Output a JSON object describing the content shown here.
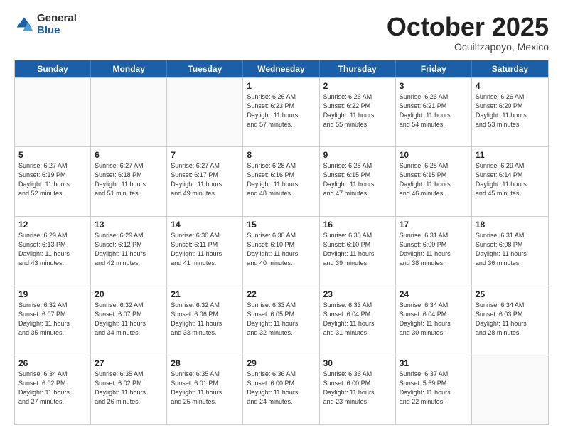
{
  "logo": {
    "general": "General",
    "blue": "Blue"
  },
  "header": {
    "title": "October 2025",
    "subtitle": "Ocuiltzapoyo, Mexico"
  },
  "weekdays": [
    "Sunday",
    "Monday",
    "Tuesday",
    "Wednesday",
    "Thursday",
    "Friday",
    "Saturday"
  ],
  "weeks": [
    [
      {
        "day": "",
        "info": ""
      },
      {
        "day": "",
        "info": ""
      },
      {
        "day": "",
        "info": ""
      },
      {
        "day": "1",
        "info": "Sunrise: 6:26 AM\nSunset: 6:23 PM\nDaylight: 11 hours\nand 57 minutes."
      },
      {
        "day": "2",
        "info": "Sunrise: 6:26 AM\nSunset: 6:22 PM\nDaylight: 11 hours\nand 55 minutes."
      },
      {
        "day": "3",
        "info": "Sunrise: 6:26 AM\nSunset: 6:21 PM\nDaylight: 11 hours\nand 54 minutes."
      },
      {
        "day": "4",
        "info": "Sunrise: 6:26 AM\nSunset: 6:20 PM\nDaylight: 11 hours\nand 53 minutes."
      }
    ],
    [
      {
        "day": "5",
        "info": "Sunrise: 6:27 AM\nSunset: 6:19 PM\nDaylight: 11 hours\nand 52 minutes."
      },
      {
        "day": "6",
        "info": "Sunrise: 6:27 AM\nSunset: 6:18 PM\nDaylight: 11 hours\nand 51 minutes."
      },
      {
        "day": "7",
        "info": "Sunrise: 6:27 AM\nSunset: 6:17 PM\nDaylight: 11 hours\nand 49 minutes."
      },
      {
        "day": "8",
        "info": "Sunrise: 6:28 AM\nSunset: 6:16 PM\nDaylight: 11 hours\nand 48 minutes."
      },
      {
        "day": "9",
        "info": "Sunrise: 6:28 AM\nSunset: 6:15 PM\nDaylight: 11 hours\nand 47 minutes."
      },
      {
        "day": "10",
        "info": "Sunrise: 6:28 AM\nSunset: 6:15 PM\nDaylight: 11 hours\nand 46 minutes."
      },
      {
        "day": "11",
        "info": "Sunrise: 6:29 AM\nSunset: 6:14 PM\nDaylight: 11 hours\nand 45 minutes."
      }
    ],
    [
      {
        "day": "12",
        "info": "Sunrise: 6:29 AM\nSunset: 6:13 PM\nDaylight: 11 hours\nand 43 minutes."
      },
      {
        "day": "13",
        "info": "Sunrise: 6:29 AM\nSunset: 6:12 PM\nDaylight: 11 hours\nand 42 minutes."
      },
      {
        "day": "14",
        "info": "Sunrise: 6:30 AM\nSunset: 6:11 PM\nDaylight: 11 hours\nand 41 minutes."
      },
      {
        "day": "15",
        "info": "Sunrise: 6:30 AM\nSunset: 6:10 PM\nDaylight: 11 hours\nand 40 minutes."
      },
      {
        "day": "16",
        "info": "Sunrise: 6:30 AM\nSunset: 6:10 PM\nDaylight: 11 hours\nand 39 minutes."
      },
      {
        "day": "17",
        "info": "Sunrise: 6:31 AM\nSunset: 6:09 PM\nDaylight: 11 hours\nand 38 minutes."
      },
      {
        "day": "18",
        "info": "Sunrise: 6:31 AM\nSunset: 6:08 PM\nDaylight: 11 hours\nand 36 minutes."
      }
    ],
    [
      {
        "day": "19",
        "info": "Sunrise: 6:32 AM\nSunset: 6:07 PM\nDaylight: 11 hours\nand 35 minutes."
      },
      {
        "day": "20",
        "info": "Sunrise: 6:32 AM\nSunset: 6:07 PM\nDaylight: 11 hours\nand 34 minutes."
      },
      {
        "day": "21",
        "info": "Sunrise: 6:32 AM\nSunset: 6:06 PM\nDaylight: 11 hours\nand 33 minutes."
      },
      {
        "day": "22",
        "info": "Sunrise: 6:33 AM\nSunset: 6:05 PM\nDaylight: 11 hours\nand 32 minutes."
      },
      {
        "day": "23",
        "info": "Sunrise: 6:33 AM\nSunset: 6:04 PM\nDaylight: 11 hours\nand 31 minutes."
      },
      {
        "day": "24",
        "info": "Sunrise: 6:34 AM\nSunset: 6:04 PM\nDaylight: 11 hours\nand 30 minutes."
      },
      {
        "day": "25",
        "info": "Sunrise: 6:34 AM\nSunset: 6:03 PM\nDaylight: 11 hours\nand 28 minutes."
      }
    ],
    [
      {
        "day": "26",
        "info": "Sunrise: 6:34 AM\nSunset: 6:02 PM\nDaylight: 11 hours\nand 27 minutes."
      },
      {
        "day": "27",
        "info": "Sunrise: 6:35 AM\nSunset: 6:02 PM\nDaylight: 11 hours\nand 26 minutes."
      },
      {
        "day": "28",
        "info": "Sunrise: 6:35 AM\nSunset: 6:01 PM\nDaylight: 11 hours\nand 25 minutes."
      },
      {
        "day": "29",
        "info": "Sunrise: 6:36 AM\nSunset: 6:00 PM\nDaylight: 11 hours\nand 24 minutes."
      },
      {
        "day": "30",
        "info": "Sunrise: 6:36 AM\nSunset: 6:00 PM\nDaylight: 11 hours\nand 23 minutes."
      },
      {
        "day": "31",
        "info": "Sunrise: 6:37 AM\nSunset: 5:59 PM\nDaylight: 11 hours\nand 22 minutes."
      },
      {
        "day": "",
        "info": ""
      }
    ]
  ]
}
